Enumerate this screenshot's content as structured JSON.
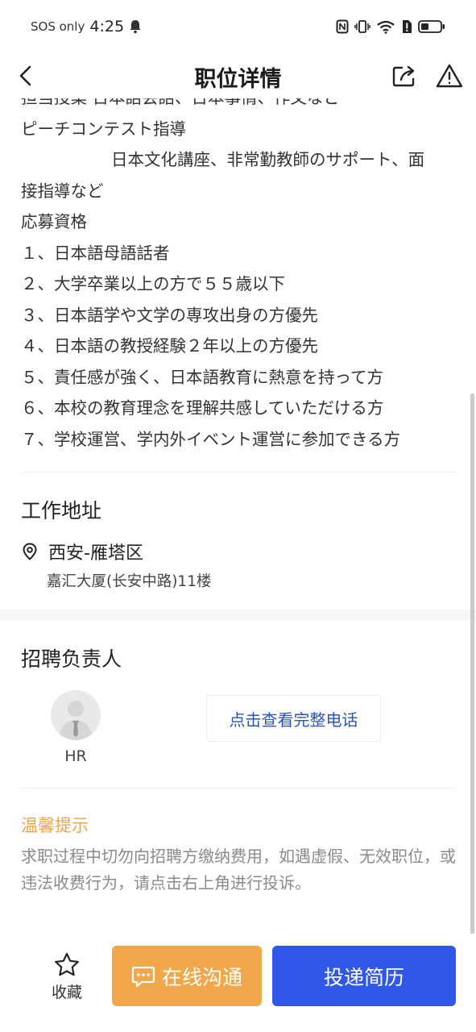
{
  "status_bar": {
    "carrier": "SOS only",
    "time": "4:25"
  },
  "header": {
    "title": "职位详情"
  },
  "description": {
    "lines": [
      "担当授業 日本語会話、日本事情、作文など",
      "ピーチコンテスト指導",
      "日本文化講座、非常勤教師のサポート、面",
      "接指導など",
      "応募資格",
      "１、日本語母語話者",
      "２、大学卒業以上の方で５５歳以下",
      "３、日本語学や文学の専攻出身の方優先",
      "４、日本語の教授経験２年以上の方優先",
      "５、責任感が強く、日本語教育に熱意を持って方",
      "６、本校の教育理念を理解共感していただける方",
      "７、学校運営、学内外イベント運営に参加できる方"
    ]
  },
  "work_address": {
    "title": "工作地址",
    "city": "西安-雁塔区",
    "address": "嘉汇大厦(长安中路)11楼"
  },
  "recruiter": {
    "title": "招聘负责人",
    "name": "HR",
    "phone_button": "点击查看完整电话"
  },
  "tips": {
    "title": "温馨提示",
    "text": "求职过程中切勿向招聘方缴纳费用，如遇虚假、无效职位，或违法收费行为，请点击右上角进行投诉。"
  },
  "bottom_bar": {
    "favorite_label": "收藏",
    "chat_label": "在线沟通",
    "resume_label": "投递简历"
  },
  "colors": {
    "accent_orange": "#f0a84a",
    "primary_blue": "#2f58e8",
    "link_blue": "#2b55b8",
    "tip_orange": "#f0a445"
  },
  "icons": {
    "back": "chevron-left-icon",
    "share": "share-icon",
    "report": "warning-icon",
    "location": "location-pin-icon",
    "favorite": "star-outline-icon",
    "chat": "chat-bubble-icon"
  }
}
